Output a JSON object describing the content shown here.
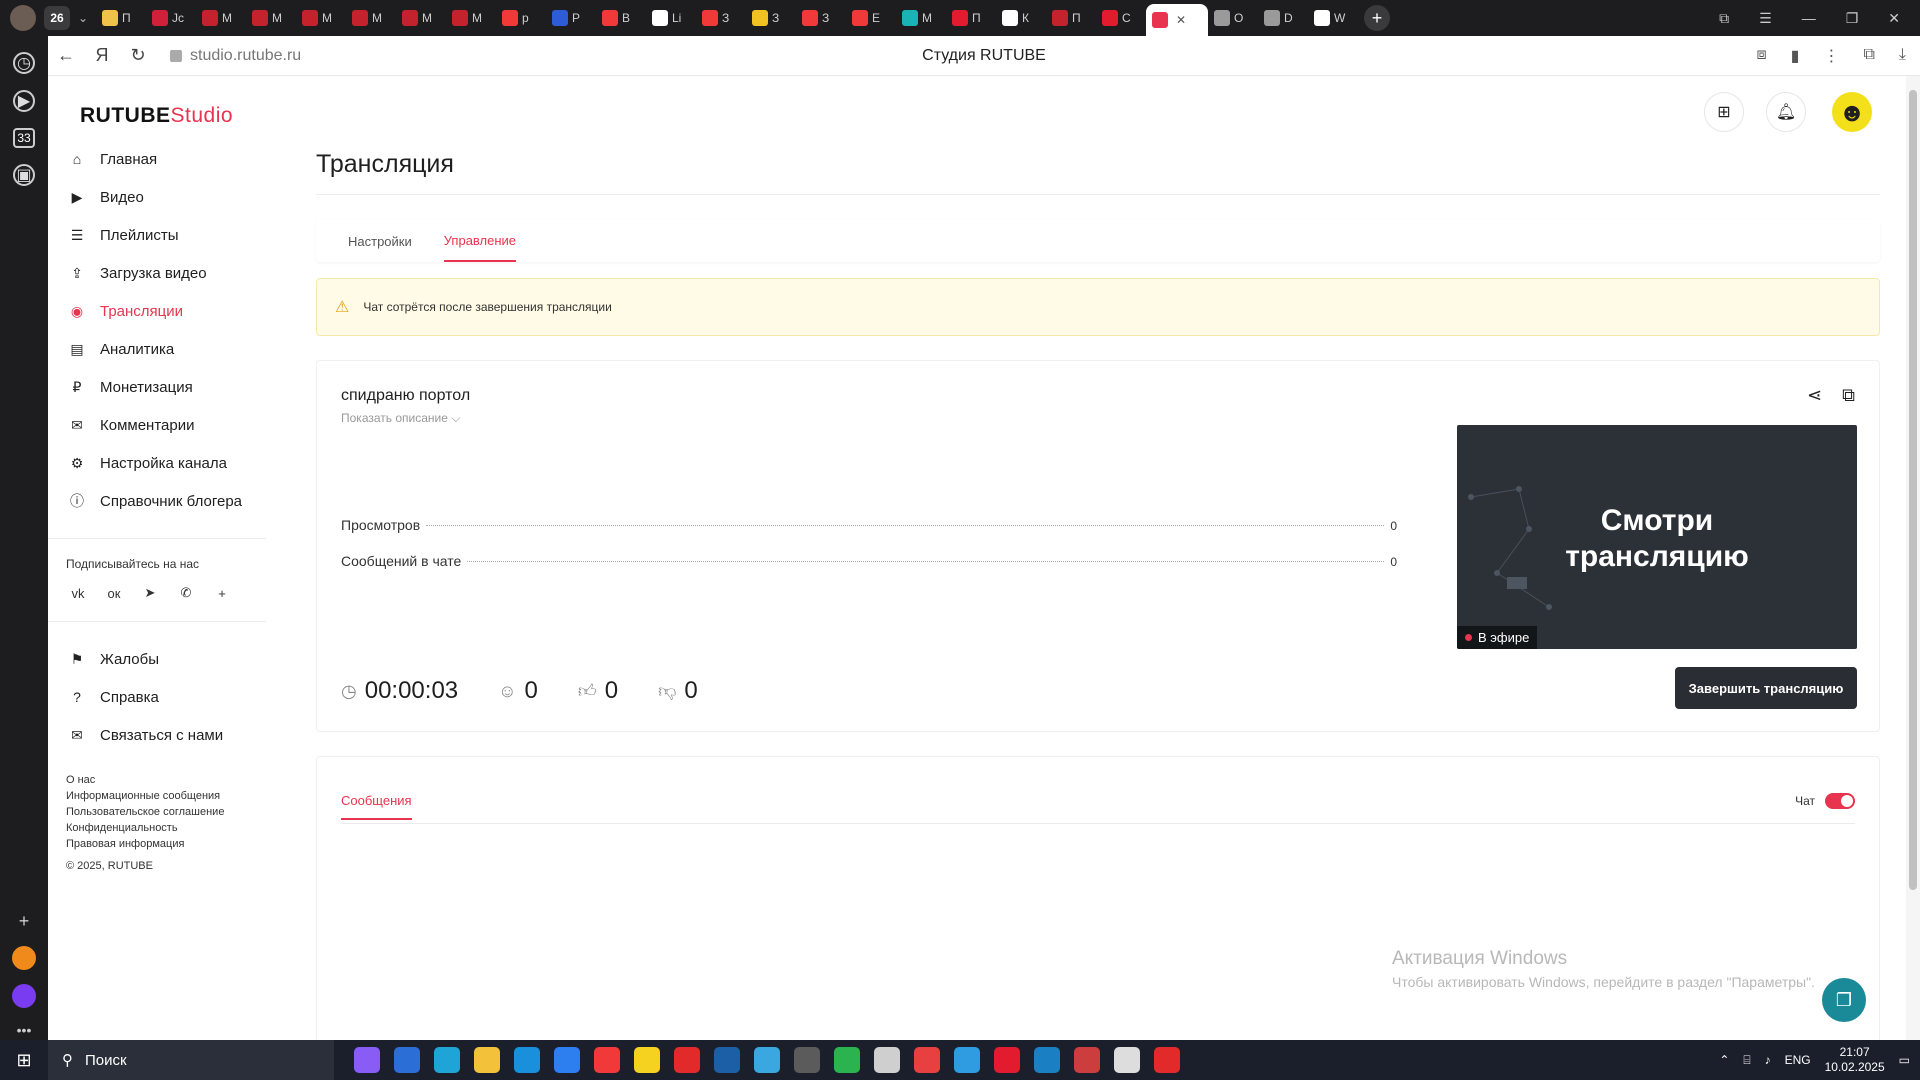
{
  "browser": {
    "tab_count": "26",
    "tabs": [
      {
        "label": "П",
        "color": "#f0c24b"
      },
      {
        "label": "Jc",
        "color": "#d0203a"
      },
      {
        "label": "М",
        "color": "#c4222c"
      },
      {
        "label": "М",
        "color": "#c4222c"
      },
      {
        "label": "М",
        "color": "#c4222c"
      },
      {
        "label": "М",
        "color": "#c4222c"
      },
      {
        "label": "М",
        "color": "#c4222c"
      },
      {
        "label": "М",
        "color": "#c4222c"
      },
      {
        "label": "р",
        "color": "#f2393a"
      },
      {
        "label": "Р",
        "color": "#2e5bd6"
      },
      {
        "label": "В",
        "color": "#f2393a"
      },
      {
        "label": "Li",
        "color": "#ffffff"
      },
      {
        "label": "З",
        "color": "#f2393a"
      },
      {
        "label": "З",
        "color": "#f2c122"
      },
      {
        "label": "З",
        "color": "#f2393a"
      },
      {
        "label": "E",
        "color": "#f2393a"
      },
      {
        "label": "М",
        "color": "#1ab4b4"
      },
      {
        "label": "П",
        "color": "#e21b2e"
      },
      {
        "label": "К",
        "color": "#ffffff"
      },
      {
        "label": "П",
        "color": "#c4222c"
      },
      {
        "label": "С",
        "color": "#e21b2e"
      }
    ],
    "active_tab_close": "✕",
    "tabs_after": [
      {
        "label": "О",
        "color": "#9a9a9a"
      },
      {
        "label": "D",
        "color": "#9a9a9a"
      },
      {
        "label": "W",
        "color": "#ffffff"
      }
    ],
    "url": "studio.rutube.ru",
    "page_title": "Студия RUTUBE"
  },
  "app": {
    "logo_main": "RUTUBE",
    "logo_studio": "Studio",
    "accent": "#e8344e"
  },
  "sidebar": {
    "items": [
      {
        "label": "Главная",
        "icon": "home-icon",
        "glyph": "⌂"
      },
      {
        "label": "Видео",
        "icon": "video-icon",
        "glyph": "▶"
      },
      {
        "label": "Плейлисты",
        "icon": "playlist-icon",
        "glyph": "☰"
      },
      {
        "label": "Загрузка видео",
        "icon": "upload-icon",
        "glyph": "⇪"
      },
      {
        "label": "Трансляции",
        "icon": "broadcast-icon",
        "glyph": "◉"
      },
      {
        "label": "Аналитика",
        "icon": "analytics-icon",
        "glyph": "▤"
      },
      {
        "label": "Монетизация",
        "icon": "monetization-icon",
        "glyph": "₽"
      },
      {
        "label": "Комментарии",
        "icon": "comments-icon",
        "glyph": "✉"
      },
      {
        "label": "Настройка канала",
        "icon": "settings-icon",
        "glyph": "⚙"
      },
      {
        "label": "Справочник блогера",
        "icon": "info-icon",
        "glyph": "ⓘ"
      }
    ],
    "subscribe_title": "Подписывайтесь на нас",
    "socials": [
      {
        "icon": "vk-icon",
        "glyph": "vk"
      },
      {
        "icon": "odnoklassniki-icon",
        "glyph": "ок"
      },
      {
        "icon": "telegram-icon",
        "glyph": "➤"
      },
      {
        "icon": "viber-icon",
        "glyph": "✆"
      },
      {
        "icon": "more-icon",
        "glyph": "+"
      }
    ],
    "bottom_items": [
      {
        "label": "Жалобы",
        "icon": "flag-icon",
        "glyph": "⚑"
      },
      {
        "label": "Справка",
        "icon": "help-icon",
        "glyph": "?"
      },
      {
        "label": "Связаться с нами",
        "icon": "mail-icon",
        "glyph": "✉"
      }
    ],
    "footer_links": [
      "О нас",
      "Информационные сообщения",
      "Пользовательское соглашение",
      "Конфиденциальность",
      "Правовая информация"
    ],
    "copyright": "© 2025, RUTUBE"
  },
  "main": {
    "title": "Трансляция",
    "tabs": [
      {
        "label": "Настройки",
        "active": false
      },
      {
        "label": "Управление",
        "active": true
      }
    ],
    "warning": "Чат сотрётся после завершения трансляции",
    "stream": {
      "name": "спидраню портол",
      "show_description": "Показать описание ⌵",
      "stats": [
        {
          "label": "Просмотров",
          "value": "0"
        },
        {
          "label": "Сообщений в чате",
          "value": "0"
        }
      ],
      "duration": "00:00:03",
      "viewers": "0",
      "likes": "0",
      "dislikes": "0",
      "preview_line1": "Смотри",
      "preview_line2": "трансляцию",
      "live_label": "В эфире",
      "end_button": "Завершить трансляцию"
    },
    "messages": {
      "tab_label": "Сообщения",
      "chat_label": "Чат",
      "chat_enabled": true
    }
  },
  "windows": {
    "watermark_title": "Активация Windows",
    "watermark_sub": "Чтобы активировать Windows, перейдите в раздел \"Параметры\".",
    "search_label": "Поиск",
    "lang": "ENG",
    "time": "21:07",
    "date": "10.02.2025",
    "taskbar_apps": [
      "#8a5cf6",
      "#2b6fd6",
      "#1fa4d8",
      "#f3c13a",
      "#1a8fdc",
      "#2d7ff0",
      "#f2393a",
      "#f4d21f",
      "#e22a2a",
      "#1c5fa6",
      "#3aa7e0",
      "#5b5b5b",
      "#2bb34f",
      "#cfcfcf",
      "#e84040",
      "#2f9be0",
      "#e21b2e",
      "#1b7fc4",
      "#cc3e3e",
      "#dddddd",
      "#e22a2a"
    ]
  }
}
